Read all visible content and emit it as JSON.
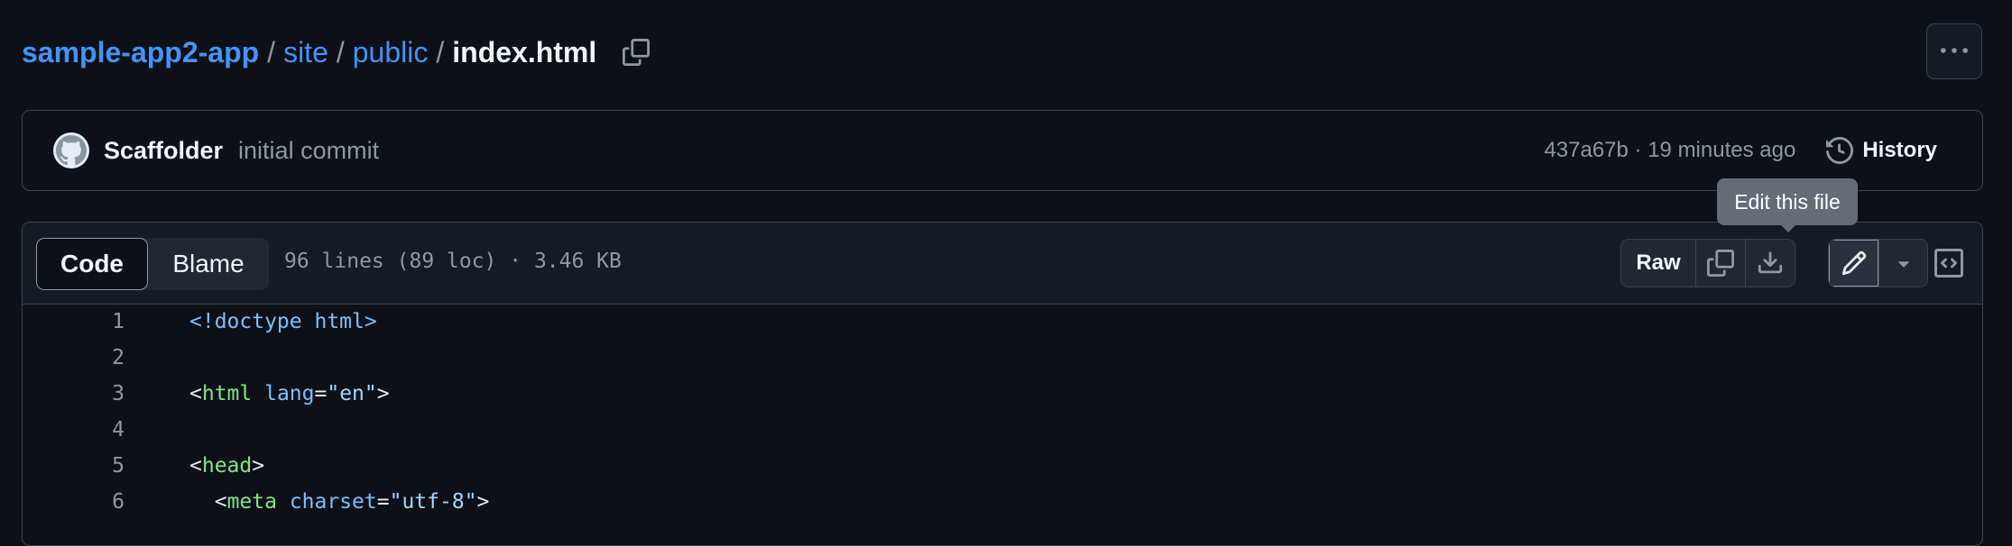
{
  "breadcrumb": {
    "repo": "sample-app2-app",
    "sep": "/",
    "path1": "site",
    "path2": "public",
    "file": "index.html"
  },
  "commit": {
    "author": "Scaffolder",
    "message": "initial commit",
    "meta": "437a67b · 19 minutes ago",
    "history_label": "History"
  },
  "tooltip": "Edit this file",
  "file_header": {
    "tab_code": "Code",
    "tab_blame": "Blame",
    "info": "96 lines (89 loc) · 3.46 KB",
    "raw_label": "Raw"
  },
  "code": {
    "lines": [
      {
        "num": "1",
        "doctype": "<!doctype html>"
      },
      {
        "num": "2"
      },
      {
        "num": "3",
        "open": "<",
        "tag": "html",
        "attr": "lang",
        "eq": "=",
        "val": "\"en\"",
        "close": ">"
      },
      {
        "num": "4"
      },
      {
        "num": "5",
        "open": "<",
        "tag": "head",
        "close": ">"
      },
      {
        "num": "6",
        "indent": "  ",
        "open": "<",
        "tag": "meta",
        "attr": "charset",
        "eq": "=",
        "val": "\"utf-8\"",
        "close": ">"
      }
    ]
  },
  "colors": {
    "background": "#0d1117",
    "link": "#4493f8",
    "border": "#3d444d",
    "muted": "#9198a1"
  },
  "icons": [
    "copy-icon",
    "kebab-icon",
    "github-avatar",
    "history-icon",
    "download-icon",
    "pencil-icon",
    "triangle-down-icon",
    "code-square-icon"
  ]
}
